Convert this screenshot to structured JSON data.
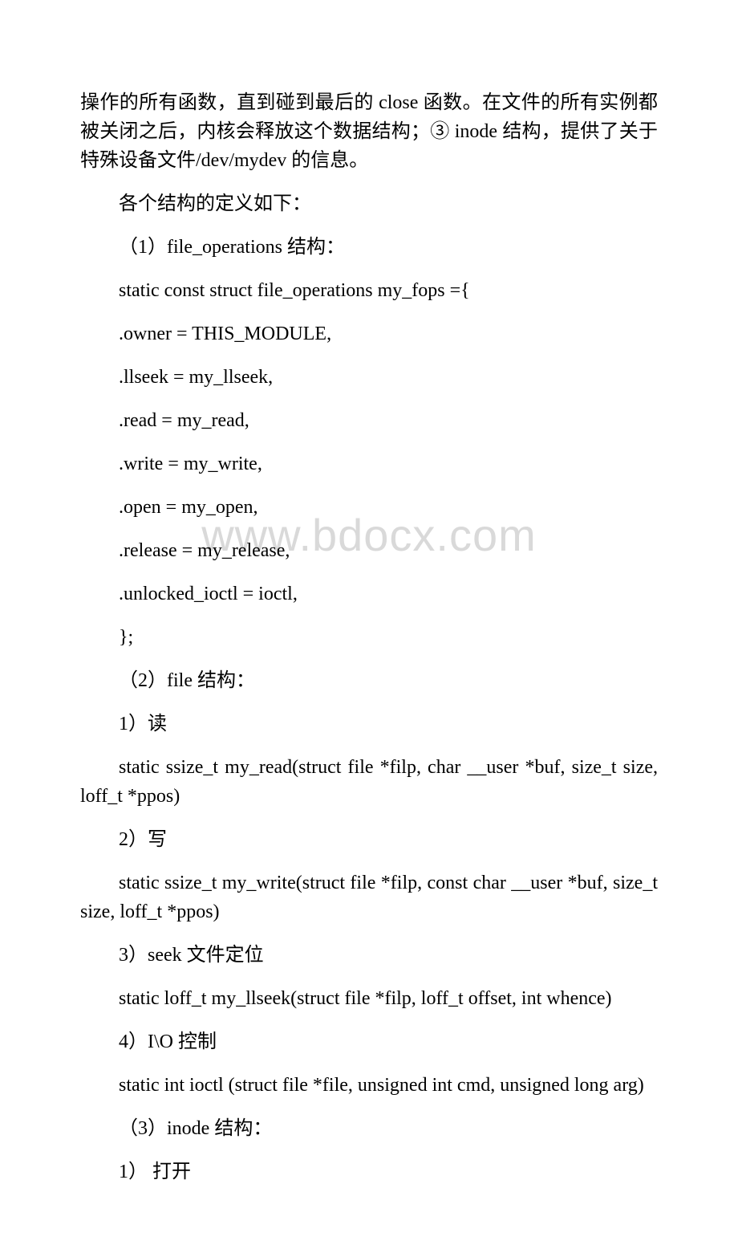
{
  "watermark": "www.bdocx.com",
  "p": {
    "l0": "操作的所有函数，直到碰到最后的 close 函数。在文件的所有实例都被关闭之后，内核会释放这个数据结构；③ inode 结构，提供了关于特殊设备文件/dev/mydev 的信息。",
    "l1": "各个结构的定义如下：",
    "l2": "（1）file_operations 结构：",
    "l3": "static const struct file_operations my_fops ={",
    "l4": ".owner = THIS_MODULE,",
    "l5": ".llseek = my_llseek,",
    "l6": ".read = my_read,",
    "l7": ".write = my_write,",
    "l8": ".open = my_open,",
    "l9": ".release = my_release,",
    "l10": ".unlocked_ioctl = ioctl,",
    "l11": "};",
    "l12": "（2）file 结构：",
    "l13": "1）读",
    "l14": "static ssize_t my_read(struct file *filp, char __user *buf, size_t size, loff_t *ppos)",
    "l15": "2）写",
    "l16": "static ssize_t my_write(struct file *filp, const char __user *buf, size_t size, loff_t *ppos)",
    "l17": "3）seek 文件定位",
    "l18": "static loff_t my_llseek(struct file *filp, loff_t offset, int whence)",
    "l19": "4）I\\O 控制",
    "l20": "static int ioctl (struct file *file, unsigned int cmd, unsigned long arg)",
    "l21": "（3）inode 结构：",
    "l22": "1） 打开"
  }
}
